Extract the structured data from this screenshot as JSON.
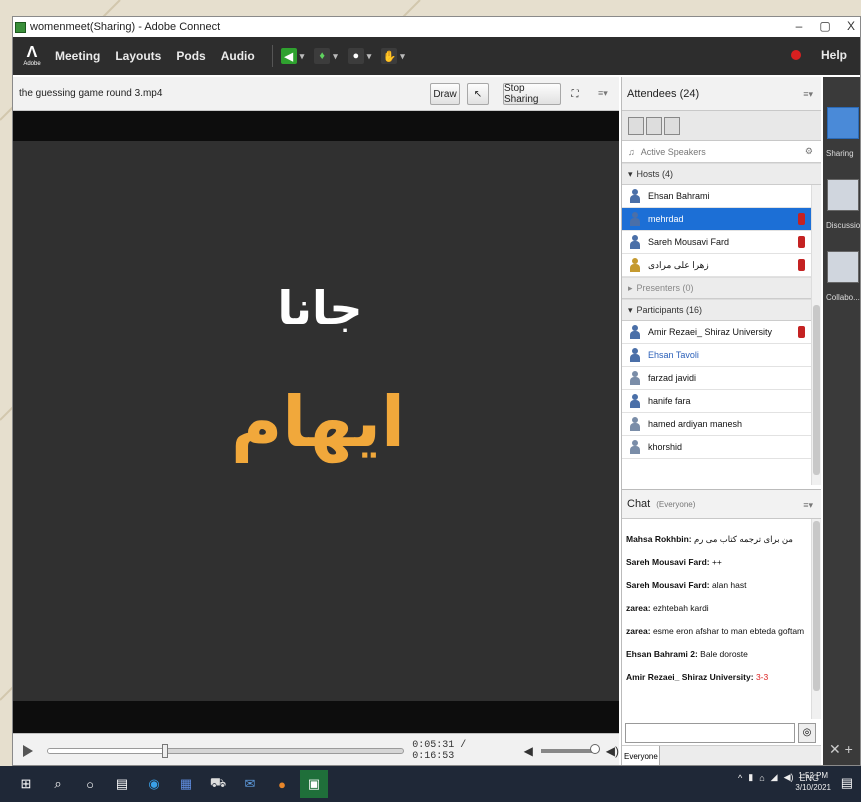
{
  "window": {
    "title": "womenmeet(Sharing) - Adobe Connect",
    "minimize": "–",
    "maximize": "▢",
    "close": "X"
  },
  "menubar": {
    "logo_text": "Adobe",
    "items": [
      "Meeting",
      "Layouts",
      "Pods",
      "Audio"
    ],
    "help": "Help"
  },
  "share_pod": {
    "title": "the guessing game round 3.mp4",
    "draw_button": "Draw",
    "stop_sharing_button": "Stop Sharing",
    "video_word_top": "جانا",
    "video_word_bottom": "ایهام",
    "time_display": "0:05:31 / 0:16:53",
    "seek_progress": 0.33,
    "volume_level": 1.0
  },
  "attendees": {
    "title": "Attendees (24)",
    "active_speakers": "Active Speakers",
    "hosts_header": "Hosts (4)",
    "hosts": [
      {
        "name": "Ehsan Bahrami",
        "selected": false,
        "hand": false
      },
      {
        "name": "mehrdad",
        "selected": true,
        "hand": true
      },
      {
        "name": "Sareh Mousavi Fard",
        "selected": false,
        "hand": true
      },
      {
        "name": "زهرا علی مرادی",
        "selected": false,
        "hand": true
      }
    ],
    "presenters_header": "Presenters (0)",
    "participants_header": "Participants (16)",
    "participants": [
      {
        "name": "Amir Rezaei_ Shiraz University",
        "hand": true
      },
      {
        "name": "Ehsan Tavoli",
        "hand": false
      },
      {
        "name": "farzad javidi",
        "hand": false
      },
      {
        "name": "hanife fara",
        "hand": false
      },
      {
        "name": "hamed ardiyan manesh",
        "hand": false
      },
      {
        "name": "khorshid",
        "hand": false
      }
    ]
  },
  "chat": {
    "title": "Chat",
    "subtitle": "(Everyone)",
    "messages": [
      {
        "who": "Mahsa Rokhbin:",
        "text": "من برای ترجمه کتاب می رم"
      },
      {
        "who": "Sareh Mousavi Fard:",
        "text": " ++"
      },
      {
        "who": "Sareh Mousavi Fard:",
        "text": " alan hast"
      },
      {
        "who": "zarea:",
        "text": " ezhtebah kardi"
      },
      {
        "who": "zarea:",
        "text": " esme eron afshar to man ebteda goftam"
      },
      {
        "who": "Ehsan Bahrami 2:",
        "text": " Bale doroste"
      },
      {
        "who": "Amir Rezaei_ Shiraz University:",
        "text": " ",
        "red": "3-3"
      }
    ],
    "everyone_tab": "Everyone"
  },
  "layouts": {
    "items": [
      "Sharing",
      "Discussion",
      "Collabo..."
    ]
  },
  "taskbar": {
    "time": "1:52 PM",
    "date": "3/10/2021",
    "lang": "ENG"
  },
  "colors": {
    "accent_selection": "#1c6fd6",
    "video_text_highlight": "#f1a83b",
    "raised_hand": "#c42222"
  }
}
